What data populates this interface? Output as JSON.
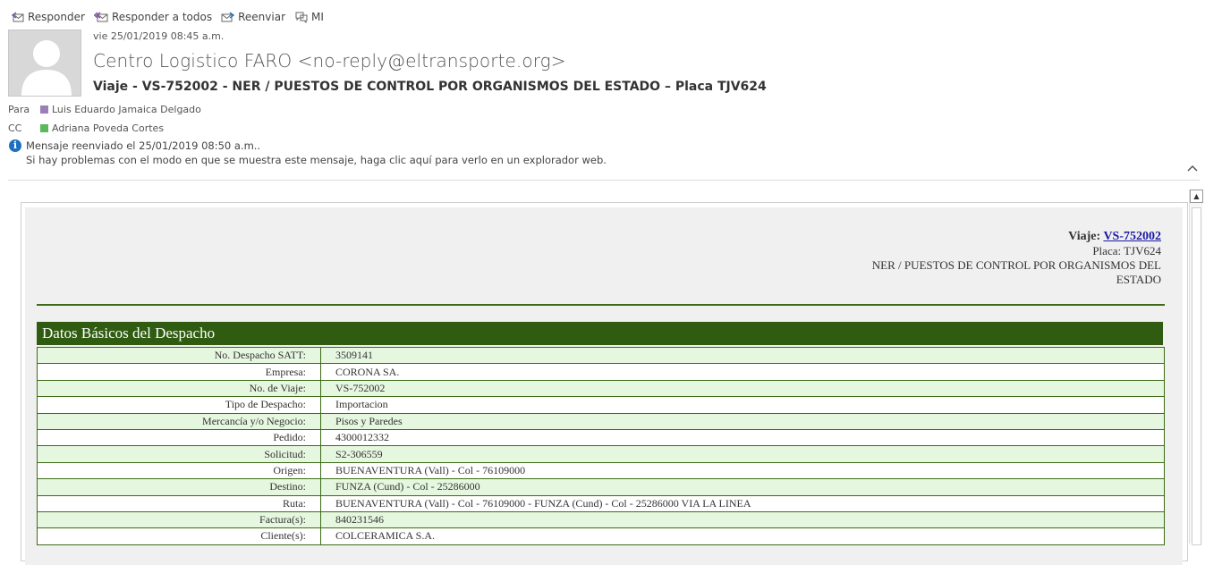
{
  "toolbar": {
    "reply": "Responder",
    "reply_all": "Responder a todos",
    "forward": "Reenviar",
    "im": "MI"
  },
  "message": {
    "date": "vie 25/01/2019 08:45 a.m.",
    "sender": "Centro Logistico FARO <no-reply@eltransporte.org>",
    "subject": "Viaje - VS-752002 - NER / PUESTOS DE CONTROL POR ORGANISMOS DEL ESTADO – Placa TJV624",
    "to_label": "Para",
    "to": "Luis Eduardo Jamaica Delgado",
    "cc_label": "CC",
    "cc": "Adriana Poveda Cortes",
    "forwarded_notice": "Mensaje reenviado el 25/01/2019 08:50 a.m..",
    "browser_notice": "Si hay problemas con el modo en que se muestra este mensaje, haga clic aquí para verlo en un explorador web.",
    "colors": {
      "to_swatch": "#9b7fb8",
      "cc_swatch": "#5cb85c"
    }
  },
  "body": {
    "trip_label": "Viaje:",
    "trip_link": "VS-752002",
    "plate": "Placa: TJV624",
    "event": "NER / PUESTOS DE CONTROL POR ORGANISMOS DEL ESTADO",
    "section_title": "Datos Básicos del Despacho",
    "rows": [
      {
        "k": "No. Despacho SATT:",
        "v": "3509141"
      },
      {
        "k": "Empresa:",
        "v": "CORONA SA."
      },
      {
        "k": "No. de Viaje:",
        "v": "VS-752002"
      },
      {
        "k": "Tipo de Despacho:",
        "v": "Importacion"
      },
      {
        "k": "Mercancía y/o Negocio:",
        "v": "Pisos y Paredes"
      },
      {
        "k": "Pedido:",
        "v": "4300012332"
      },
      {
        "k": "Solicitud:",
        "v": "S2-306559"
      },
      {
        "k": "Origen:",
        "v": "BUENAVENTURA (Vall) - Col - 76109000"
      },
      {
        "k": "Destino:",
        "v": "FUNZA (Cund) - Col - 25286000"
      },
      {
        "k": "Ruta:",
        "v": "BUENAVENTURA (Vall) - Col - 76109000 - FUNZA (Cund) - Col - 25286000 VIA LA LINEA"
      },
      {
        "k": "Factura(s):",
        "v": "840231546"
      },
      {
        "k": "Cliente(s):",
        "v": "COLCERAMICA S.A."
      }
    ],
    "colors": {
      "section_bg": "#2f5c11",
      "row_alt": "#e6f7e0",
      "link": "#1a1aa6"
    }
  }
}
